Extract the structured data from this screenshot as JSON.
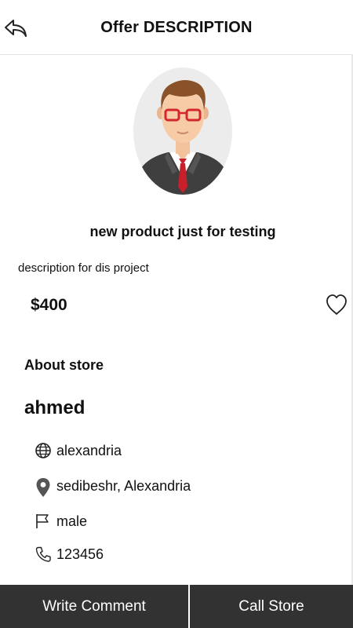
{
  "header": {
    "title": "Offer DESCRIPTION",
    "back_icon": "back-arrow-icon"
  },
  "offer": {
    "name": "new product just for testing",
    "description": "description for dis project",
    "price": "$400",
    "avatar_icon": "person-avatar",
    "favorite_icon": "heart-outline-icon"
  },
  "store": {
    "section_label": "About store",
    "name": "ahmed",
    "details": [
      {
        "icon": "globe-icon",
        "text": "alexandria"
      },
      {
        "icon": "location-pin-icon",
        "text": "sedibeshr, Alexandria"
      },
      {
        "icon": "flag-icon",
        "text": "male"
      },
      {
        "icon": "phone-icon",
        "text": "123456"
      }
    ]
  },
  "actions": {
    "write_comment": "Write Comment",
    "call_store": "Call Store"
  },
  "colors": {
    "bottom_bar": "#323232",
    "tie": "#c8202a",
    "glasses": "#d4262e"
  }
}
